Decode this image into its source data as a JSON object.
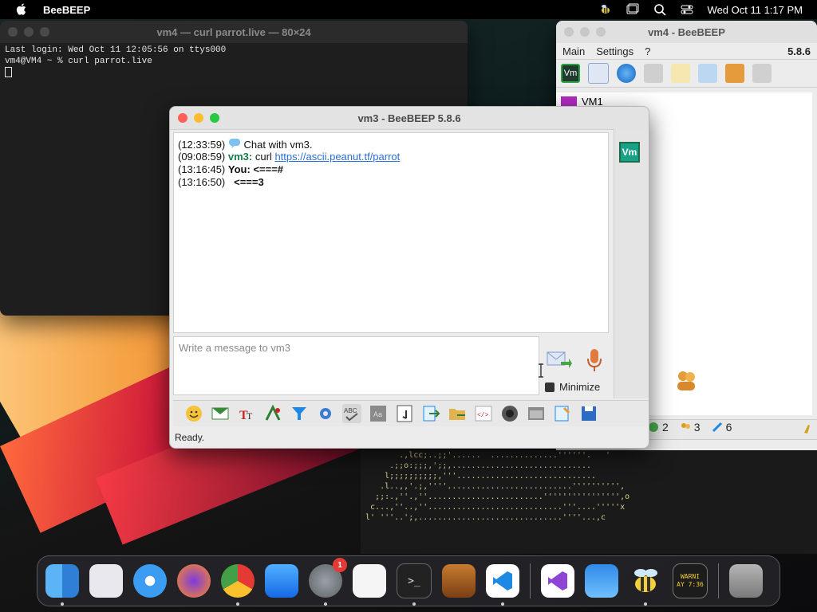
{
  "menubar": {
    "app_name": "BeeBEEP",
    "datetime": "Wed Oct 11  1:17 PM",
    "icons": [
      "apple-icon",
      "bee-icon",
      "window-icon",
      "search-icon",
      "control-center-icon"
    ]
  },
  "terminal": {
    "title": "vm4 — curl parrot.live — 80×24",
    "line1": "Last login: Wed Oct 11 12:05:56 on ttys000",
    "line2": "vm4@VM4 ~ % curl parrot.live"
  },
  "beebeep_main": {
    "title": "vm4 - BeeBEEP",
    "menu": [
      "Main",
      "Settings",
      "?"
    ],
    "version": "5.8.6",
    "user_first": "VM1",
    "counts": [
      "2",
      "3",
      "6"
    ]
  },
  "chat": {
    "title": "vm3 - BeeBEEP 5.8.6",
    "messages": [
      {
        "time": "(12:33:59)",
        "text": "Chat with vm3."
      },
      {
        "time": "(09:08:59)",
        "sender": "vm3:",
        "text": "curl",
        "link": "https://ascii.peanut.tf/parrot"
      },
      {
        "time": "(13:16:45)",
        "sender": "You:",
        "text": "<===#"
      },
      {
        "time": "(13:16:50)",
        "text": "<===3"
      }
    ],
    "sidebar_badge": "Vm",
    "input_placeholder": "Write a message to vm3",
    "minimize_label": "Minimize",
    "status": "Ready."
  },
  "dock": {
    "apps": [
      "finder",
      "launchpad",
      "safari",
      "firefox",
      "chrome",
      "app-store",
      "system-settings",
      "textedit",
      "terminal",
      "garageband",
      "vscode",
      "visual-studio",
      "weather",
      "beebeep",
      "console"
    ],
    "settings_badge": "1",
    "console_text": "WARNI\nAY 7:36"
  },
  "ascii_art": "        .,lcc;..;;'......  ..............''''''.   '  \n      .;;o:;;;,';;,.............................  \n     l;;;;;;;;;;,'''.............................  \n    .l..,,'.;,''''..........................'''''''''',\n   ;;:.,''.,''........................'''''''''''''''',o\n  c...,''..,''............................'''....'''''x\n l' '''..';,..............................''''...,c"
}
